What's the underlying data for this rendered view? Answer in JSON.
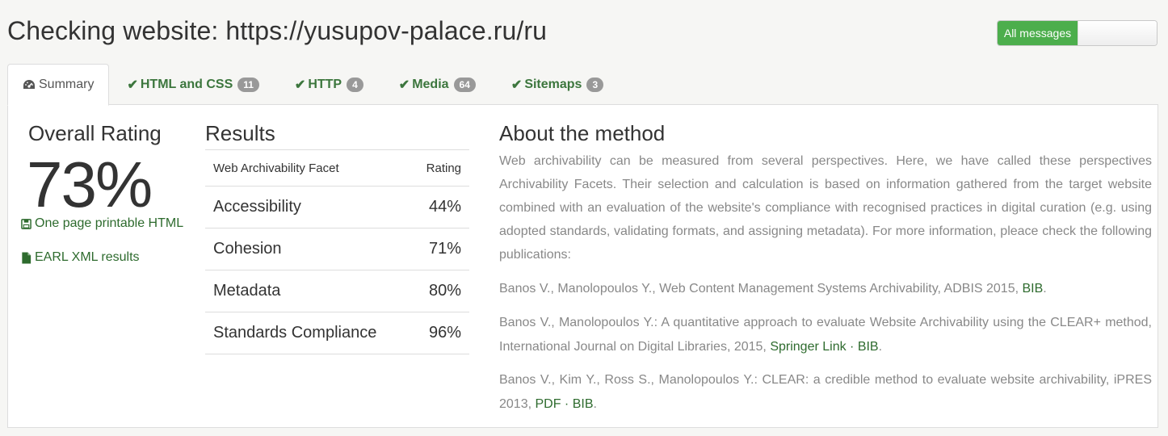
{
  "header": {
    "title": "Checking website: https://yusupov-palace.ru/ru",
    "toggle_label": "All messages"
  },
  "tabs": [
    {
      "label": "Summary",
      "icon": "dashboard-icon"
    },
    {
      "label": "HTML and CSS",
      "badge": "11",
      "icon": "check-icon"
    },
    {
      "label": "HTTP",
      "badge": "4",
      "icon": "check-icon"
    },
    {
      "label": "Media",
      "badge": "64",
      "icon": "check-icon"
    },
    {
      "label": "Sitemaps",
      "badge": "3",
      "icon": "check-icon"
    }
  ],
  "summary": {
    "overall_title": "Overall Rating",
    "overall_value": "73%",
    "printable_link": "One page printable HTML",
    "earl_link": "EARL XML results"
  },
  "results": {
    "title": "Results",
    "col_facet": "Web Archivability Facet",
    "col_rating": "Rating",
    "rows": [
      {
        "facet": "Accessibility",
        "rating": "44%"
      },
      {
        "facet": "Cohesion",
        "rating": "71%"
      },
      {
        "facet": "Metadata",
        "rating": "80%"
      },
      {
        "facet": "Standards Compliance",
        "rating": "96%"
      }
    ]
  },
  "about": {
    "title": "About the method",
    "text": "Web archivability can be measured from several perspectives. Here, we have called these perspectives Archivability Facets. Their selection and calculation is based on information gathered from the target website combined with an evaluation of the website's compliance with recognised practices in digital curation (e.g. using adopted standards, validating formats, and assigning metadata). For more information, pleace check the following publications:",
    "refs": [
      {
        "text": "Banos V., Manolopoulos Y., Web Content Management Systems Archivability, ADBIS 2015, ",
        "links": [
          "BIB"
        ],
        "end": "."
      },
      {
        "text": "Banos V., Manolopoulos Y.: A quantitative approach to evaluate Website Archivability using the CLEAR+ method, International Journal on Digital Libraries, 2015, ",
        "links": [
          "Springer Link",
          "BIB"
        ],
        "end": "."
      },
      {
        "text": "Banos V., Kim Y., Ross S., Manolopoulos Y.: CLEAR: a credible method to evaluate website archivability, iPRES 2013, ",
        "links": [
          "PDF",
          "BIB"
        ],
        "end": "."
      }
    ],
    "separator": " · "
  },
  "colors": {
    "accent_green": "#3c763d",
    "toggle_green": "#4cae4c",
    "badge_gray": "#999999"
  }
}
